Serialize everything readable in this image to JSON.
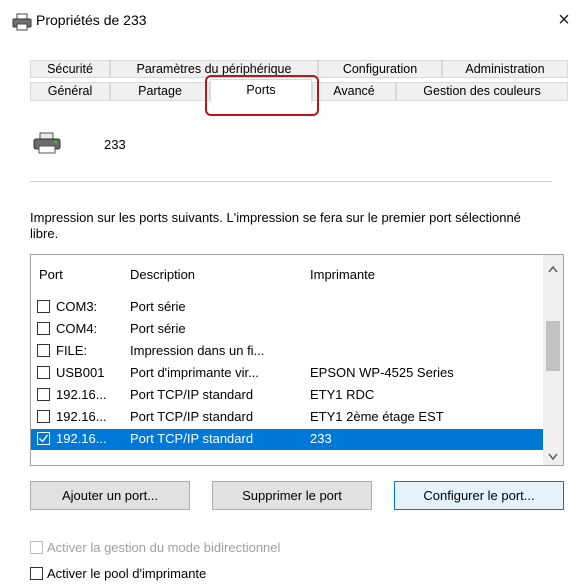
{
  "window": {
    "title": "Propriétés de 233",
    "close_glyph": "×"
  },
  "tabs_top": [
    "Sécurité",
    "Paramètres du périphérique",
    "Configuration",
    "Administration"
  ],
  "tabs_bottom": [
    "Général",
    "Partage",
    "Ports",
    "Avancé",
    "Gestion des couleurs"
  ],
  "printer": {
    "name": "233",
    "icon": "printer-icon"
  },
  "description": "Impression sur les ports suivants. L'impression se fera sur le premier port sélectionné libre.",
  "table": {
    "headers": [
      "Port",
      "Description",
      "Imprimante"
    ],
    "rows": [
      {
        "port": "COM3:",
        "description": "Port série",
        "printer": "",
        "checked": false,
        "selected": false
      },
      {
        "port": "COM4:",
        "description": "Port série",
        "printer": "",
        "checked": false,
        "selected": false
      },
      {
        "port": "FILE:",
        "description": "Impression dans un fi...",
        "printer": "",
        "checked": false,
        "selected": false
      },
      {
        "port": "USB001",
        "description": "Port d'imprimante vir...",
        "printer": "EPSON WP-4525 Series",
        "checked": false,
        "selected": false
      },
      {
        "port": "192.16...",
        "description": "Port TCP/IP standard",
        "printer": "ETY1 RDC",
        "checked": false,
        "selected": false
      },
      {
        "port": "192.16...",
        "description": "Port TCP/IP standard",
        "printer": "ETY1 2ème étage EST",
        "checked": false,
        "selected": false
      },
      {
        "port": "192.16...",
        "description": "Port TCP/IP standard",
        "printer": "233",
        "checked": true,
        "selected": true
      }
    ]
  },
  "buttons": {
    "add": "Ajouter un port...",
    "delete": "Supprimer le port",
    "configure": "Configurer le port..."
  },
  "options": {
    "bidirectional": "Activer la gestion du mode bidirectionnel",
    "pool": "Activer le pool d'imprimante"
  },
  "colors": {
    "selection": "#0078d7",
    "highlight": "#b5171f"
  }
}
